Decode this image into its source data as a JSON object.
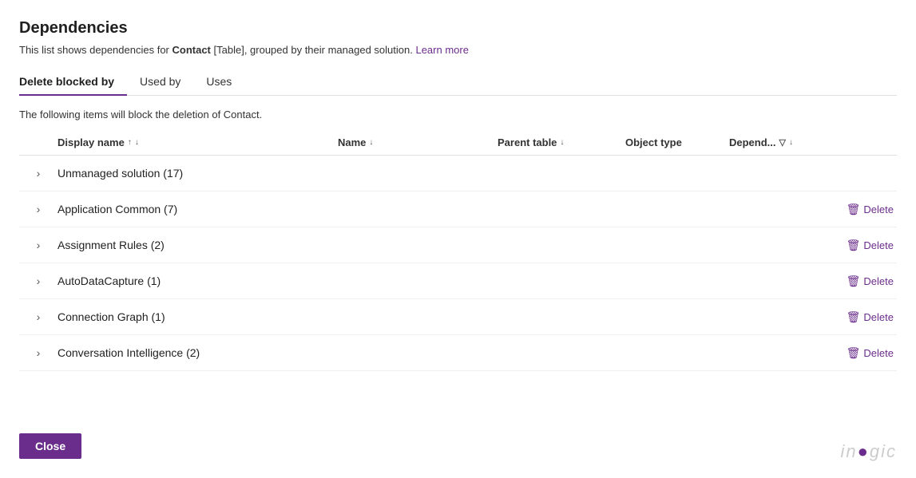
{
  "page": {
    "title": "Dependencies",
    "subtitle_prefix": "This list shows dependencies for ",
    "subtitle_entity": "Contact",
    "subtitle_entity_type": "[Table]",
    "subtitle_suffix": ", grouped by their managed solution.",
    "learn_more_label": "Learn more",
    "description": "The following items will block the deletion of Contact.",
    "tabs": [
      {
        "id": "delete-blocked-by",
        "label": "Delete blocked by",
        "active": true
      },
      {
        "id": "used-by",
        "label": "Used by",
        "active": false
      },
      {
        "id": "uses",
        "label": "Uses",
        "active": false
      }
    ],
    "columns": {
      "expand": "",
      "display_name": "Display name",
      "name": "Name",
      "parent_table": "Parent table",
      "object_type": "Object type",
      "depend": "Depend...",
      "action": ""
    },
    "rows": [
      {
        "id": "row-1",
        "label": "Unmanaged solution (17)",
        "showDelete": false
      },
      {
        "id": "row-2",
        "label": "Application Common (7)",
        "showDelete": true
      },
      {
        "id": "row-3",
        "label": "Assignment Rules (2)",
        "showDelete": true
      },
      {
        "id": "row-4",
        "label": "AutoDataCapture (1)",
        "showDelete": true
      },
      {
        "id": "row-5",
        "label": "Connection Graph (1)",
        "showDelete": true
      },
      {
        "id": "row-6",
        "label": "Conversation Intelligence (2)",
        "showDelete": true
      }
    ],
    "delete_label": "Delete",
    "close_label": "Close",
    "watermark": "in●gic"
  }
}
